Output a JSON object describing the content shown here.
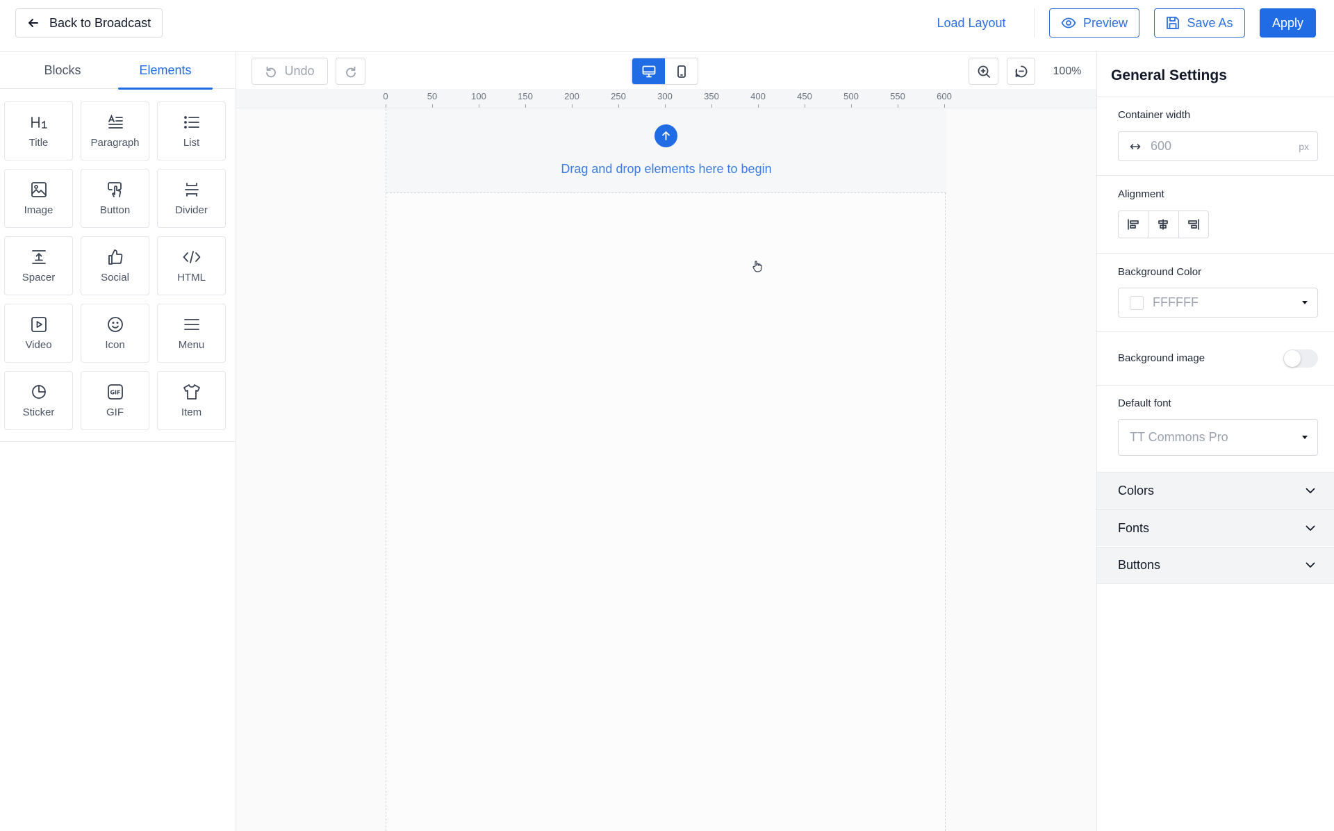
{
  "topbar": {
    "back_label": "Back to Broadcast",
    "load_layout_label": "Load Layout",
    "preview_label": "Preview",
    "save_as_label": "Save As",
    "apply_label": "Apply"
  },
  "left_panel": {
    "tabs": [
      {
        "label": "Blocks",
        "active": false
      },
      {
        "label": "Elements",
        "active": true
      }
    ],
    "elements": [
      {
        "label": "Title",
        "icon": "heading-icon"
      },
      {
        "label": "Paragraph",
        "icon": "paragraph-icon"
      },
      {
        "label": "List",
        "icon": "list-icon"
      },
      {
        "label": "Image",
        "icon": "image-icon"
      },
      {
        "label": "Button",
        "icon": "button-pointer-icon"
      },
      {
        "label": "Divider",
        "icon": "divider-icon"
      },
      {
        "label": "Spacer",
        "icon": "spacer-icon"
      },
      {
        "label": "Social",
        "icon": "thumbs-up-icon"
      },
      {
        "label": "HTML",
        "icon": "code-icon"
      },
      {
        "label": "Video",
        "icon": "video-icon"
      },
      {
        "label": "Icon",
        "icon": "smiley-icon"
      },
      {
        "label": "Menu",
        "icon": "menu-icon"
      },
      {
        "label": "Sticker",
        "icon": "sticker-icon"
      },
      {
        "label": "GIF",
        "icon": "gif-icon"
      },
      {
        "label": "Item",
        "icon": "shirt-icon"
      }
    ]
  },
  "canvas": {
    "undo_label": "Undo",
    "zoom_level": "100%",
    "active_device": "desktop",
    "ruler_labels": [
      "0",
      "50",
      "100",
      "150",
      "200",
      "250",
      "300",
      "350",
      "400",
      "450",
      "500",
      "550",
      "600"
    ],
    "drop_text": "Drag and drop elements here to begin"
  },
  "settings": {
    "title": "General Settings",
    "container_width_label": "Container width",
    "container_width_value": "600",
    "container_width_unit": "px",
    "alignment_label": "Alignment",
    "background_color_label": "Background Color",
    "background_color_value": "FFFFFF",
    "background_image_label": "Background image",
    "background_image_enabled": false,
    "default_font_label": "Default font",
    "default_font_value": "TT Commons Pro",
    "sections": [
      "Colors",
      "Fonts",
      "Buttons"
    ]
  },
  "colors": {
    "accent": "#1f6ce5",
    "link": "#2c6fdd"
  }
}
